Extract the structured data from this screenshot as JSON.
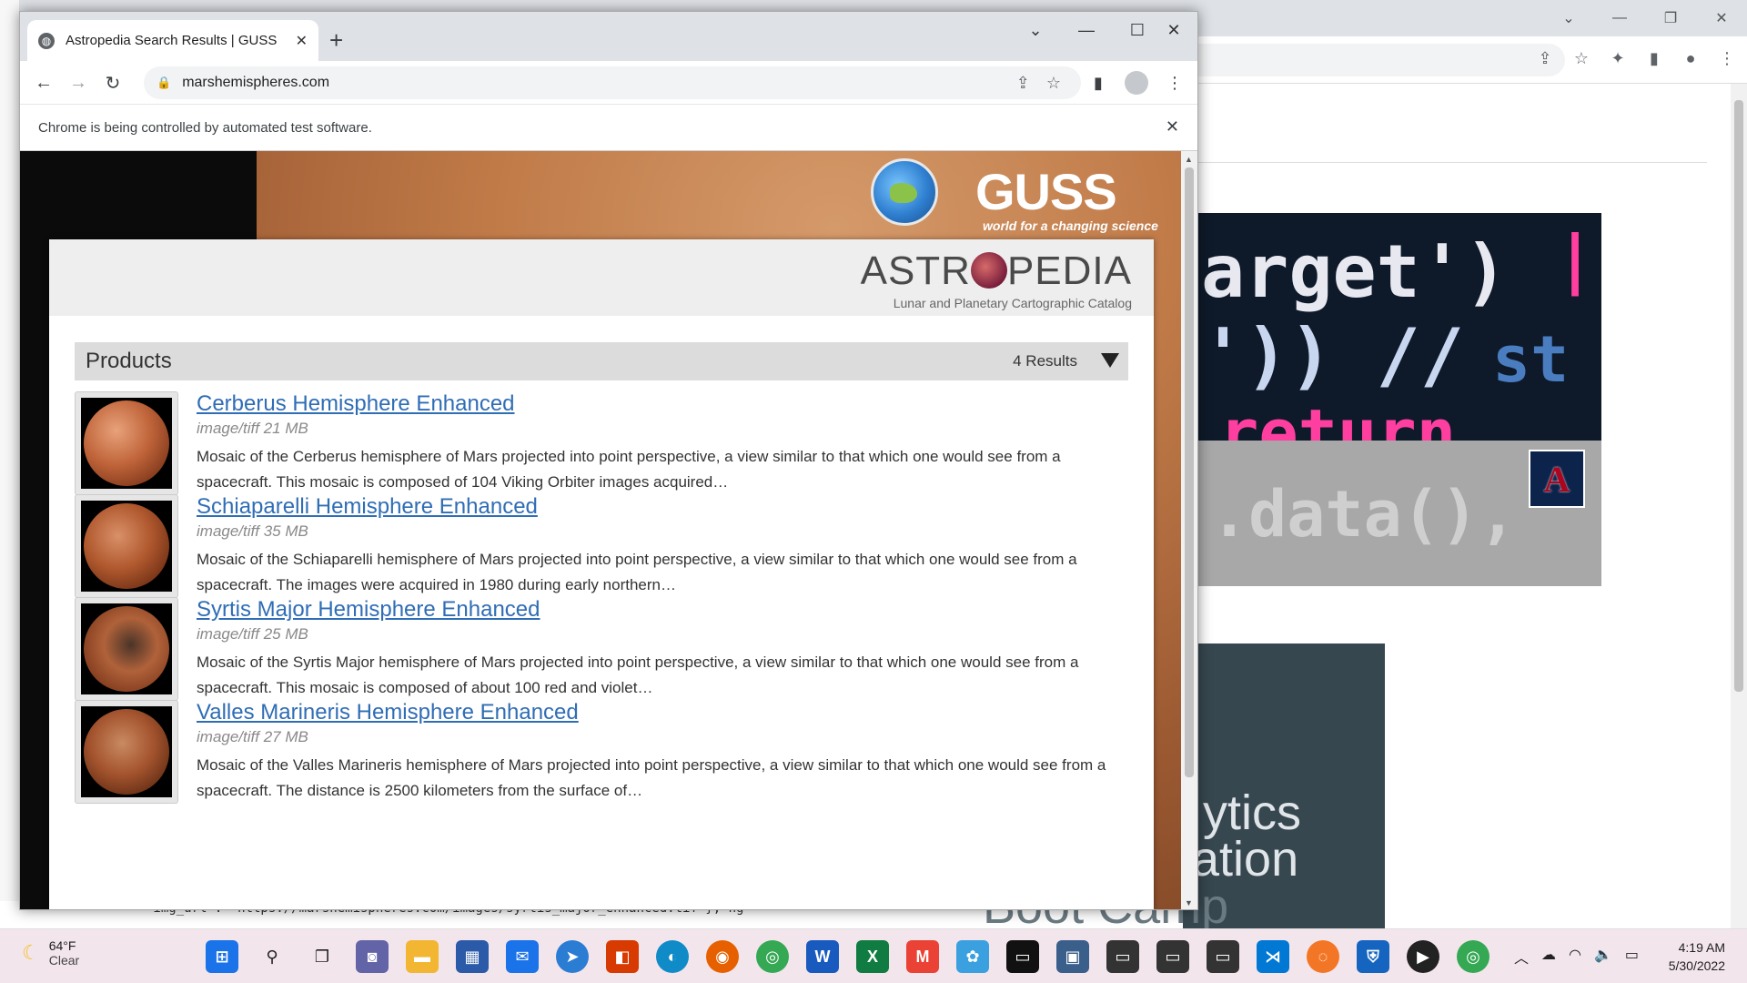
{
  "browser": {
    "tab_title": "Astropedia Search Results | GUSS",
    "url": "marshemispheres.com",
    "infobar_text": "Chrome is being controlled by automated test software."
  },
  "site": {
    "partner_name": "GUSS",
    "partner_tagline": "world for a changing science",
    "brand_left": "ASTR",
    "brand_right": "PEDIA",
    "brand_subtitle": "Lunar and Planetary Cartographic Catalog"
  },
  "products": {
    "heading": "Products",
    "count": "4 Results",
    "items": [
      {
        "title": "Cerberus Hemisphere Enhanced",
        "meta": "image/tiff 21 MB",
        "description": "Mosaic of the Cerberus hemisphere of Mars projected into point perspective, a view similar to that which one would see from a spacecraft. This mosaic is composed of 104 Viking Orbiter images acquired…"
      },
      {
        "title": "Schiaparelli Hemisphere Enhanced",
        "meta": "image/tiff 35 MB",
        "description": "Mosaic of the Schiaparelli hemisphere of Mars projected into point perspective, a view similar to that which one would see from a spacecraft. The images were acquired in 1980 during early northern…"
      },
      {
        "title": "Syrtis Major Hemisphere Enhanced",
        "meta": "image/tiff 25 MB",
        "description": "Mosaic of the Syrtis Major hemisphere of Mars projected into point perspective, a view similar to that which one would see from a spacecraft. This mosaic is composed of about 100 red and violet…"
      },
      {
        "title": "Valles Marineris Hemisphere Enhanced",
        "meta": "image/tiff 27 MB",
        "description": "Mosaic of the Valles Marineris hemisphere of Mars projected into point perspective, a view similar to that which one would see from a spacecraft. The distance is 2500 kilometers from the surface of…"
      }
    ]
  },
  "background": {
    "code_line1": "arget')",
    "code_line2": "'))  //",
    "code_line3": "return",
    "code_pink": "||",
    "code_st": "st",
    "code_lower": ".data(),",
    "card_line1": "ytics",
    "card_line2": "ation",
    "behind_text": "Boot Camp",
    "editor_text": "'img_url': 'https://marshemispheres.com/images/syrtis_major_enhanced.tif'},  ng'"
  },
  "taskbar": {
    "temperature": "64°F",
    "condition": "Clear",
    "time": "4:19 AM",
    "date": "5/30/2022"
  },
  "colors": {
    "link": "#2f6db5",
    "taskbar": "#f3e5ec"
  }
}
